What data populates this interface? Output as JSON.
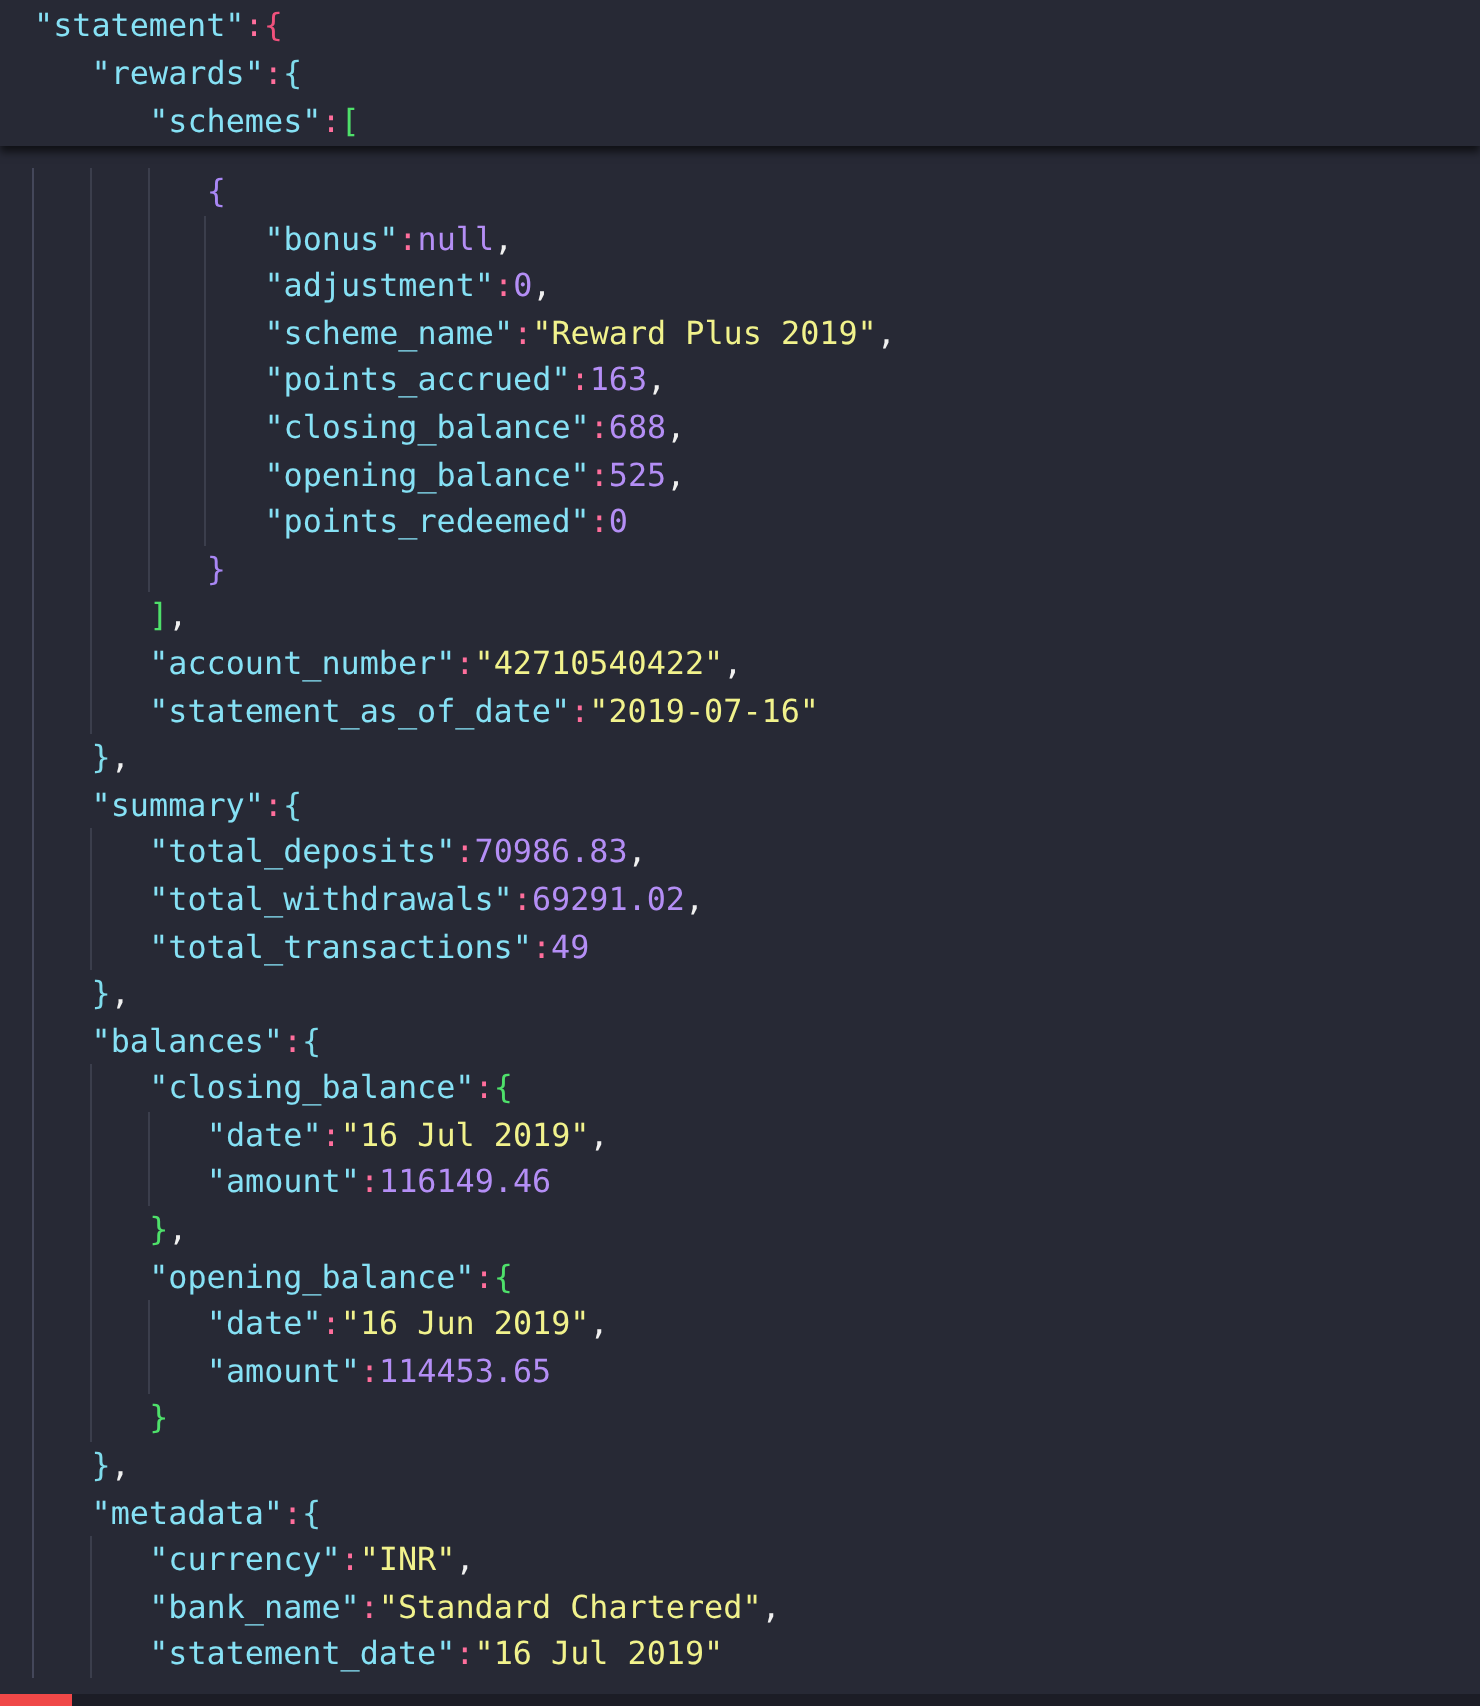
{
  "code": [
    {
      "pinned": true,
      "tokens": [
        {
          "kind": "key",
          "text": "\"statement\""
        },
        {
          "kind": "colon",
          "text": ":"
        },
        {
          "kind": "bracket",
          "text": "{",
          "color": "#f0517c"
        }
      ],
      "children": [
        {
          "pinned": true,
          "tokens": [
            {
              "kind": "key",
              "text": "\"rewards\""
            },
            {
              "kind": "colon",
              "text": ":"
            },
            {
              "kind": "bracket",
              "text": "{",
              "color": "#7fdcec"
            }
          ],
          "children": [
            {
              "pinned": true,
              "tokens": [
                {
                  "kind": "key",
                  "text": "\"schemes\""
                },
                {
                  "kind": "colon",
                  "text": ":"
                },
                {
                  "kind": "bracket",
                  "text": "[",
                  "color": "#4ee06a"
                }
              ],
              "children": [
                {
                  "pinned": false,
                  "tokens": [
                    {
                      "kind": "bracket",
                      "text": "{",
                      "color": "#a987f5"
                    }
                  ],
                  "children": [
                    {
                      "tokens": [
                        {
                          "kind": "key",
                          "text": "\"bonus\""
                        },
                        {
                          "kind": "colon",
                          "text": ":"
                        },
                        {
                          "kind": "literal",
                          "text": "null"
                        },
                        {
                          "kind": "comma",
                          "text": ","
                        }
                      ]
                    },
                    {
                      "tokens": [
                        {
                          "kind": "key",
                          "text": "\"adjustment\""
                        },
                        {
                          "kind": "colon",
                          "text": ":"
                        },
                        {
                          "kind": "number",
                          "text": "0"
                        },
                        {
                          "kind": "comma",
                          "text": ","
                        }
                      ]
                    },
                    {
                      "tokens": [
                        {
                          "kind": "key",
                          "text": "\"scheme_name\""
                        },
                        {
                          "kind": "colon",
                          "text": ":"
                        },
                        {
                          "kind": "string",
                          "text": "\"Reward Plus 2019\""
                        },
                        {
                          "kind": "comma",
                          "text": ","
                        }
                      ]
                    },
                    {
                      "tokens": [
                        {
                          "kind": "key",
                          "text": "\"points_accrued\""
                        },
                        {
                          "kind": "colon",
                          "text": ":"
                        },
                        {
                          "kind": "number",
                          "text": "163"
                        },
                        {
                          "kind": "comma",
                          "text": ","
                        }
                      ]
                    },
                    {
                      "tokens": [
                        {
                          "kind": "key",
                          "text": "\"closing_balance\""
                        },
                        {
                          "kind": "colon",
                          "text": ":"
                        },
                        {
                          "kind": "number",
                          "text": "688"
                        },
                        {
                          "kind": "comma",
                          "text": ","
                        }
                      ]
                    },
                    {
                      "tokens": [
                        {
                          "kind": "key",
                          "text": "\"opening_balance\""
                        },
                        {
                          "kind": "colon",
                          "text": ":"
                        },
                        {
                          "kind": "number",
                          "text": "525"
                        },
                        {
                          "kind": "comma",
                          "text": ","
                        }
                      ]
                    },
                    {
                      "tokens": [
                        {
                          "kind": "key",
                          "text": "\"points_redeemed\""
                        },
                        {
                          "kind": "colon",
                          "text": ":"
                        },
                        {
                          "kind": "number",
                          "text": "0"
                        }
                      ]
                    }
                  ],
                  "end": [
                    {
                      "kind": "bracket",
                      "text": "}",
                      "color": "#a987f5"
                    }
                  ]
                }
              ],
              "end": [
                {
                  "kind": "bracket",
                  "text": "]",
                  "color": "#4ee06a"
                },
                {
                  "kind": "comma",
                  "text": ","
                }
              ]
            },
            {
              "tokens": [
                {
                  "kind": "key",
                  "text": "\"account_number\""
                },
                {
                  "kind": "colon",
                  "text": ":"
                },
                {
                  "kind": "string",
                  "text": "\"42710540422\""
                },
                {
                  "kind": "comma",
                  "text": ","
                }
              ]
            },
            {
              "tokens": [
                {
                  "kind": "key",
                  "text": "\"statement_as_of_date\""
                },
                {
                  "kind": "colon",
                  "text": ":"
                },
                {
                  "kind": "string",
                  "text": "\"2019-07-16\""
                }
              ]
            }
          ],
          "end": [
            {
              "kind": "bracket",
              "text": "}",
              "color": "#7fdcec"
            },
            {
              "kind": "comma",
              "text": ","
            }
          ]
        },
        {
          "pinned": false,
          "tokens": [
            {
              "kind": "key",
              "text": "\"summary\""
            },
            {
              "kind": "colon",
              "text": ":"
            },
            {
              "kind": "bracket",
              "text": "{",
              "color": "#7fdcec"
            }
          ],
          "children": [
            {
              "tokens": [
                {
                  "kind": "key",
                  "text": "\"total_deposits\""
                },
                {
                  "kind": "colon",
                  "text": ":"
                },
                {
                  "kind": "number",
                  "text": "70986.83"
                },
                {
                  "kind": "comma",
                  "text": ","
                }
              ]
            },
            {
              "tokens": [
                {
                  "kind": "key",
                  "text": "\"total_withdrawals\""
                },
                {
                  "kind": "colon",
                  "text": ":"
                },
                {
                  "kind": "number",
                  "text": "69291.02"
                },
                {
                  "kind": "comma",
                  "text": ","
                }
              ]
            },
            {
              "tokens": [
                {
                  "kind": "key",
                  "text": "\"total_transactions\""
                },
                {
                  "kind": "colon",
                  "text": ":"
                },
                {
                  "kind": "number",
                  "text": "49"
                }
              ]
            }
          ],
          "end": [
            {
              "kind": "bracket",
              "text": "}",
              "color": "#7fdcec"
            },
            {
              "kind": "comma",
              "text": ","
            }
          ]
        },
        {
          "pinned": false,
          "tokens": [
            {
              "kind": "key",
              "text": "\"balances\""
            },
            {
              "kind": "colon",
              "text": ":"
            },
            {
              "kind": "bracket",
              "text": "{",
              "color": "#7fdcec"
            }
          ],
          "children": [
            {
              "pinned": false,
              "tokens": [
                {
                  "kind": "key",
                  "text": "\"closing_balance\""
                },
                {
                  "kind": "colon",
                  "text": ":"
                },
                {
                  "kind": "bracket",
                  "text": "{",
                  "color": "#4ee06a"
                }
              ],
              "children": [
                {
                  "tokens": [
                    {
                      "kind": "key",
                      "text": "\"date\""
                    },
                    {
                      "kind": "colon",
                      "text": ":"
                    },
                    {
                      "kind": "string",
                      "text": "\"16 Jul 2019\""
                    },
                    {
                      "kind": "comma",
                      "text": ","
                    }
                  ]
                },
                {
                  "tokens": [
                    {
                      "kind": "key",
                      "text": "\"amount\""
                    },
                    {
                      "kind": "colon",
                      "text": ":"
                    },
                    {
                      "kind": "number",
                      "text": "116149.46"
                    }
                  ]
                }
              ],
              "end": [
                {
                  "kind": "bracket",
                  "text": "}",
                  "color": "#4ee06a"
                },
                {
                  "kind": "comma",
                  "text": ","
                }
              ]
            },
            {
              "pinned": false,
              "tokens": [
                {
                  "kind": "key",
                  "text": "\"opening_balance\""
                },
                {
                  "kind": "colon",
                  "text": ":"
                },
                {
                  "kind": "bracket",
                  "text": "{",
                  "color": "#4ee06a"
                }
              ],
              "children": [
                {
                  "tokens": [
                    {
                      "kind": "key",
                      "text": "\"date\""
                    },
                    {
                      "kind": "colon",
                      "text": ":"
                    },
                    {
                      "kind": "string",
                      "text": "\"16 Jun 2019\""
                    },
                    {
                      "kind": "comma",
                      "text": ","
                    }
                  ]
                },
                {
                  "tokens": [
                    {
                      "kind": "key",
                      "text": "\"amount\""
                    },
                    {
                      "kind": "colon",
                      "text": ":"
                    },
                    {
                      "kind": "number",
                      "text": "114453.65"
                    }
                  ]
                }
              ],
              "end": [
                {
                  "kind": "bracket",
                  "text": "}",
                  "color": "#4ee06a"
                }
              ]
            }
          ],
          "end": [
            {
              "kind": "bracket",
              "text": "}",
              "color": "#7fdcec"
            },
            {
              "kind": "comma",
              "text": ","
            }
          ]
        },
        {
          "pinned": false,
          "tokens": [
            {
              "kind": "key",
              "text": "\"metadata\""
            },
            {
              "kind": "colon",
              "text": ":"
            },
            {
              "kind": "bracket",
              "text": "{",
              "color": "#7fdcec"
            }
          ],
          "children": [
            {
              "tokens": [
                {
                  "kind": "key",
                  "text": "\"currency\""
                },
                {
                  "kind": "colon",
                  "text": ":"
                },
                {
                  "kind": "string",
                  "text": "\"INR\""
                },
                {
                  "kind": "comma",
                  "text": ","
                }
              ]
            },
            {
              "tokens": [
                {
                  "kind": "key",
                  "text": "\"bank_name\""
                },
                {
                  "kind": "colon",
                  "text": ":"
                },
                {
                  "kind": "string",
                  "text": "\"Standard Chartered\""
                },
                {
                  "kind": "comma",
                  "text": ","
                }
              ]
            },
            {
              "tokens": [
                {
                  "kind": "key",
                  "text": "\"statement_date\""
                },
                {
                  "kind": "colon",
                  "text": ":"
                },
                {
                  "kind": "string",
                  "text": "\"16 Jul 2019\""
                }
              ]
            }
          ]
        }
      ]
    }
  ]
}
